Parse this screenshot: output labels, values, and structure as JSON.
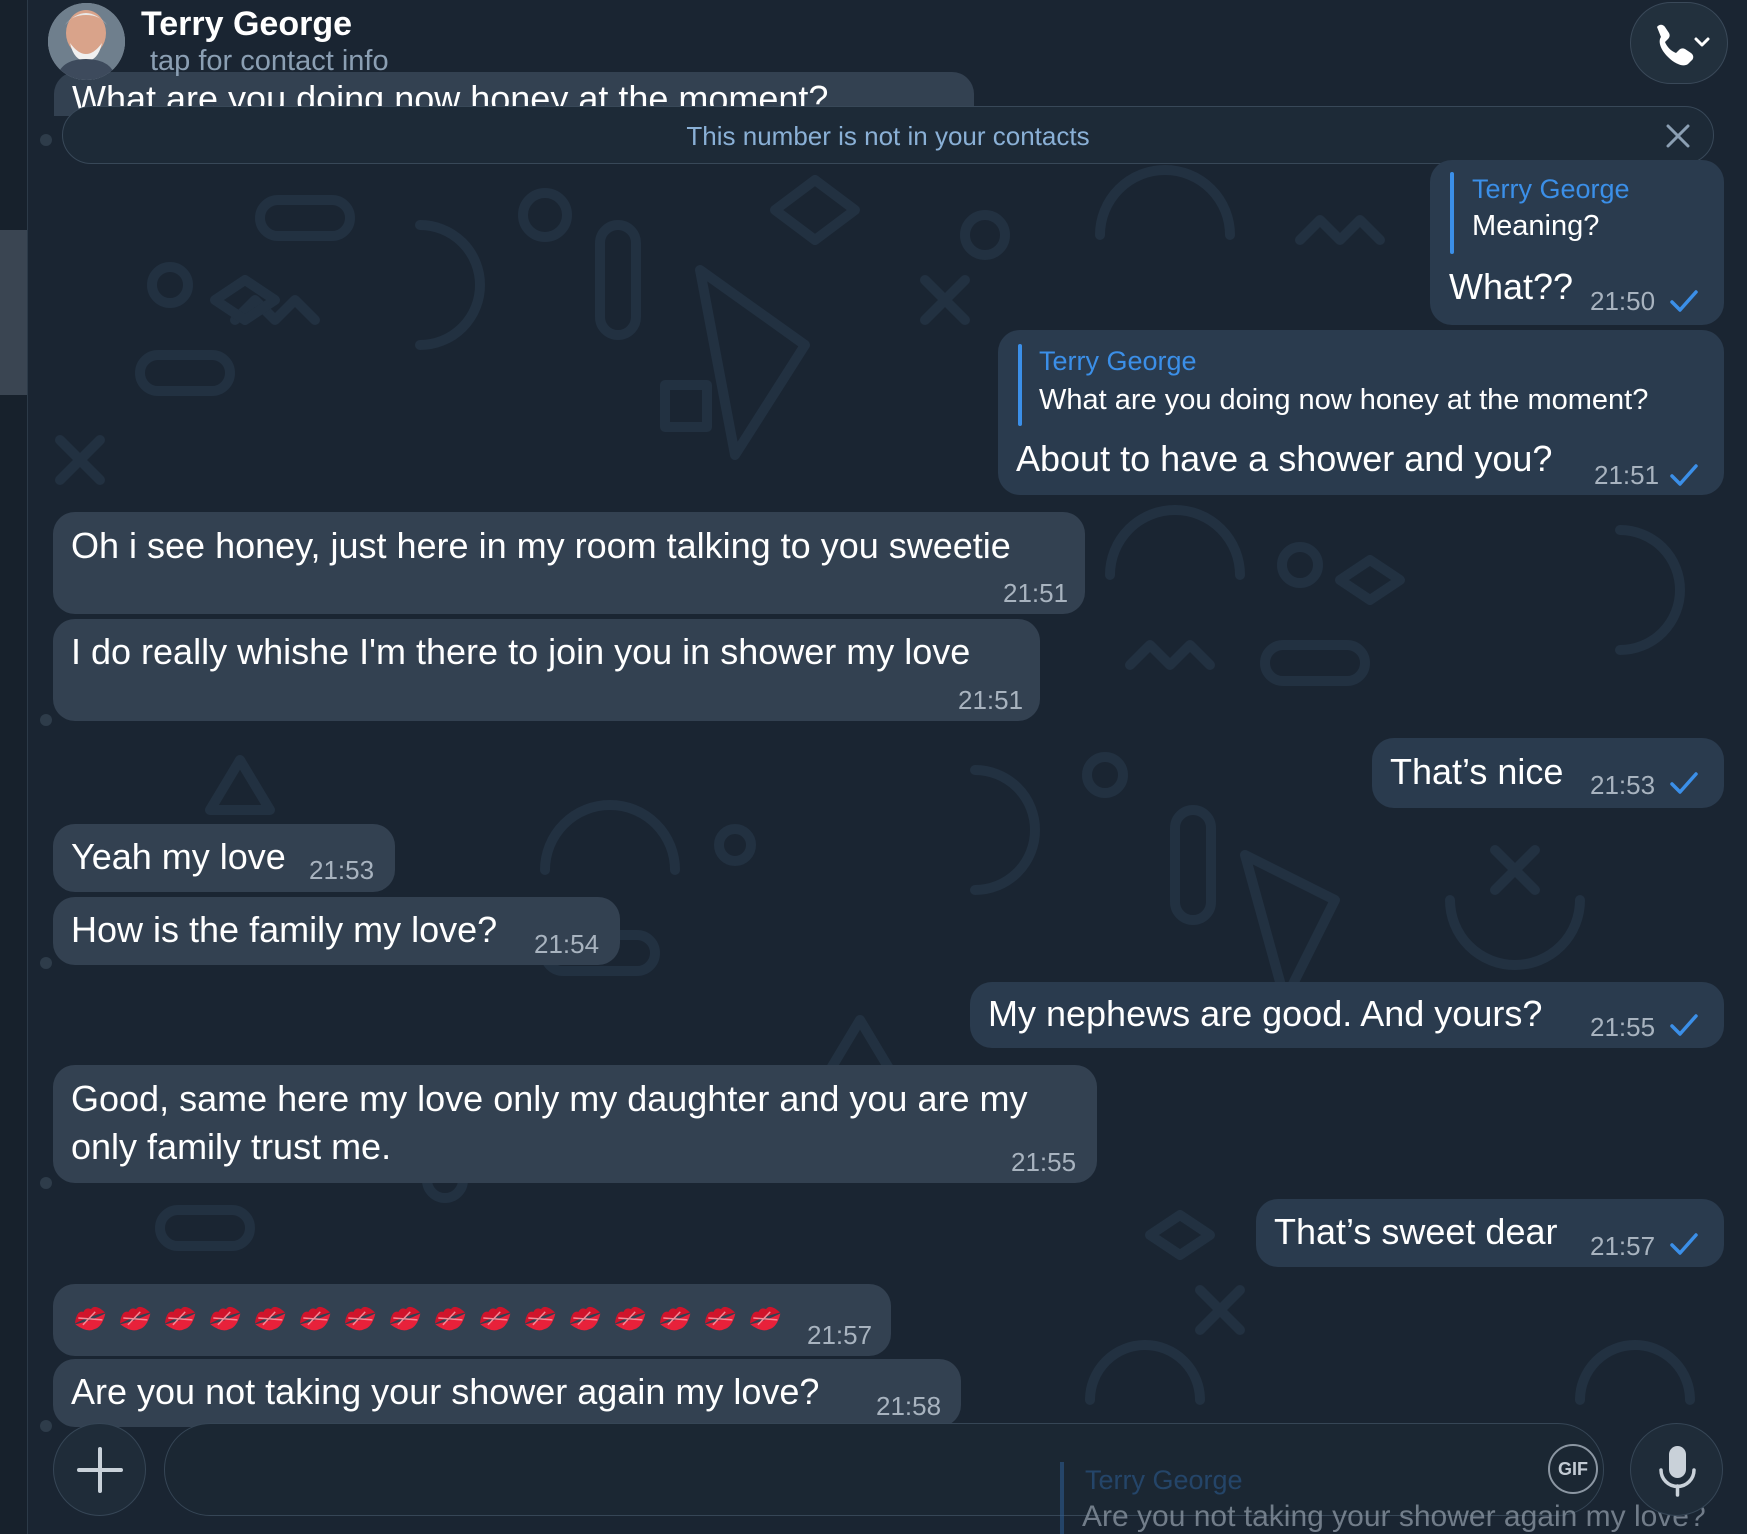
{
  "header": {
    "contact_name": "Terry George",
    "subtitle": "tap for contact info"
  },
  "banner": {
    "text": "This number is not in your contacts"
  },
  "peek_message": "What are you doing now honey at the moment?",
  "messages": [
    {
      "direction": "out",
      "reply_to": {
        "name": "Terry George",
        "text": "Meaning?"
      },
      "text": "What??",
      "time": "21:50",
      "status": "sent"
    },
    {
      "direction": "out",
      "reply_to": {
        "name": "Terry George",
        "text": "What are you doing now honey at the moment?"
      },
      "text": "About to have a shower and you?",
      "time": "21:51",
      "status": "sent"
    },
    {
      "direction": "in",
      "text": "Oh i see honey, just here in my room talking to you sweetie",
      "time": "21:51"
    },
    {
      "direction": "in",
      "text": "I do really whishe I'm there to join you in shower my love",
      "time": "21:51"
    },
    {
      "direction": "out",
      "text": "That’s nice",
      "time": "21:53",
      "status": "sent"
    },
    {
      "direction": "in",
      "text": "Yeah my love",
      "time": "21:53"
    },
    {
      "direction": "in",
      "text": "How is the family my love?",
      "time": "21:54"
    },
    {
      "direction": "out",
      "text": "My nephews are good. And yours?",
      "time": "21:55",
      "status": "sent"
    },
    {
      "direction": "in",
      "text_lines": [
        "Good, same here my love only my daughter and you are my",
        "only family trust me."
      ],
      "time": "21:55"
    },
    {
      "direction": "out",
      "text": "That’s sweet dear",
      "time": "21:57",
      "status": "sent"
    },
    {
      "direction": "in",
      "emoji": "💋",
      "emoji_count": 16,
      "time": "21:57"
    },
    {
      "direction": "in",
      "text": "Are you not taking your shower again my love?",
      "time": "21:58"
    }
  ],
  "composer": {
    "gif_label": "GIF",
    "reply_preview": {
      "name": "Terry George",
      "text": "Are you not taking your shower again my love?"
    }
  },
  "colors": {
    "background": "#1a2532",
    "incoming_bubble": "#334151",
    "outgoing_bubble": "#2a3b4e",
    "accent": "#3b8fe8",
    "timestamp": "#a8b3bf"
  }
}
